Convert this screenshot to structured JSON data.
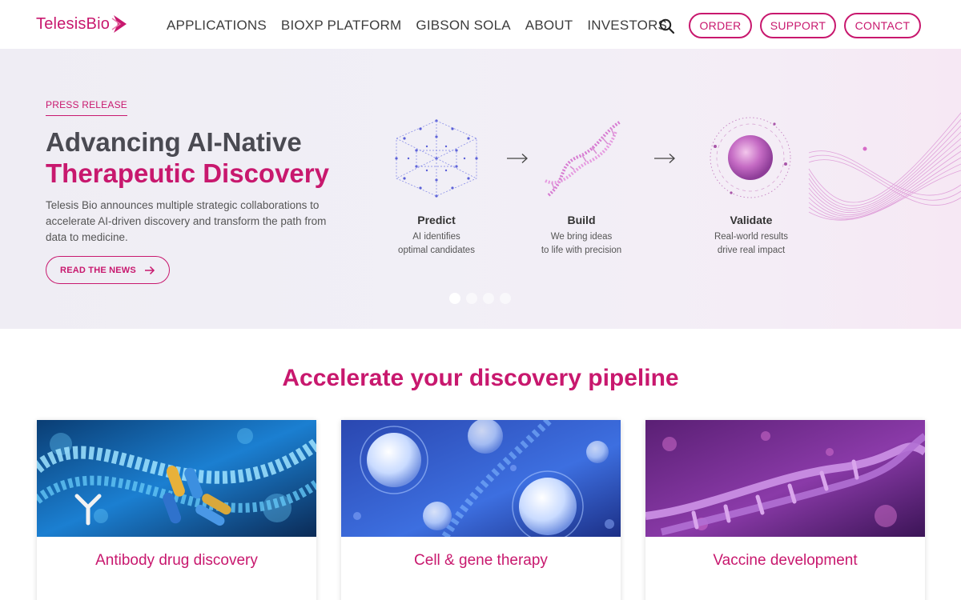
{
  "header": {
    "logo_text": "TelesisBio",
    "nav": [
      "APPLICATIONS",
      "BIOXP PLATFORM",
      "GIBSON SOLA",
      "ABOUT",
      "INVESTORS"
    ],
    "order_label": "ORDER",
    "support_label": "SUPPORT",
    "contact_label": "CONTACT"
  },
  "hero": {
    "kicker": "PRESS RELEASE",
    "title_line1": "Advancing AI-Native",
    "title_line2": "Therapeutic Discovery",
    "description": "Telesis Bio announces multiple strategic collaborations to accelerate AI-driven discovery and transform the path from data to medicine.",
    "cta_label": "READ THE NEWS",
    "stages": [
      {
        "title": "Predict",
        "line1": "AI identifies",
        "line2": "optimal candidates"
      },
      {
        "title": "Build",
        "line1": "We bring ideas",
        "line2": "to life with precision"
      },
      {
        "title": "Validate",
        "line1": "Real-world results",
        "line2": "drive real impact"
      }
    ],
    "slide_count": 4,
    "active_slide": 1
  },
  "section": {
    "title": "Accelerate your discovery pipeline",
    "cards": [
      {
        "title": "Antibody drug discovery"
      },
      {
        "title": "Cell & gene therapy"
      },
      {
        "title": "Vaccine development"
      }
    ]
  },
  "colors": {
    "brand": "#c8186e",
    "text_dark": "#4a4a52"
  }
}
